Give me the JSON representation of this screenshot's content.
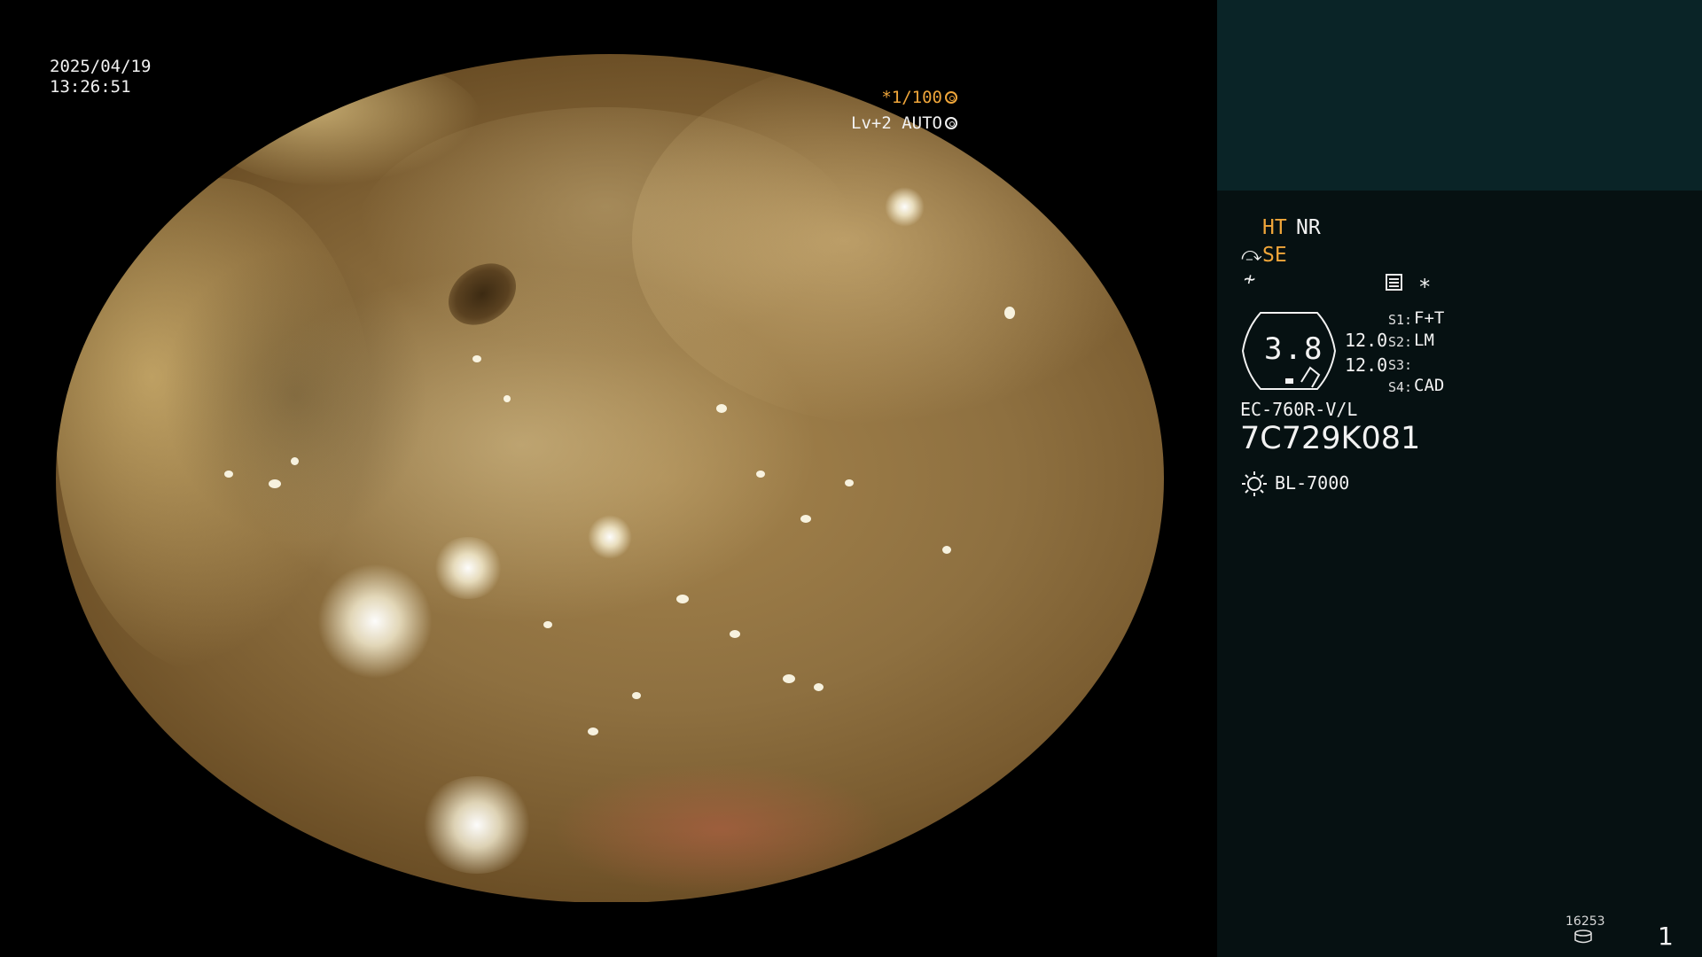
{
  "video": {
    "date": "2025/04/19",
    "time": "13:26:51",
    "shutter": "*1/100",
    "exposure": "Lv+2 AUTO"
  },
  "panel": {
    "mode_ht": "HT",
    "mode_nr": "NR",
    "mode_se": "SE",
    "magnification": "3.8",
    "levels": [
      "12.0",
      "12.0"
    ],
    "slots": [
      {
        "label": "S1:",
        "value": "F+T"
      },
      {
        "label": "S2:",
        "value": "LM"
      },
      {
        "label": "S3:",
        "value": ""
      },
      {
        "label": "S4:",
        "value": "CAD"
      }
    ],
    "scope_model": "EC-760R-V/L",
    "scope_serial": "7C729K081",
    "light_source": "BL-7000",
    "image_counter": "16253",
    "page_number": "1"
  },
  "colors": {
    "accent_orange": "#f0a63a",
    "panel_bg": "#061112",
    "thumb_bg": "#0a2427"
  },
  "icons": {
    "shutter_mode": "aperture-icon",
    "exposure_mode": "iris-icon",
    "bend": "scope-bend-icon",
    "enhance": "enhance-icon",
    "menu": "settings-icon",
    "light": "sun-icon",
    "storage": "storage-icon"
  }
}
